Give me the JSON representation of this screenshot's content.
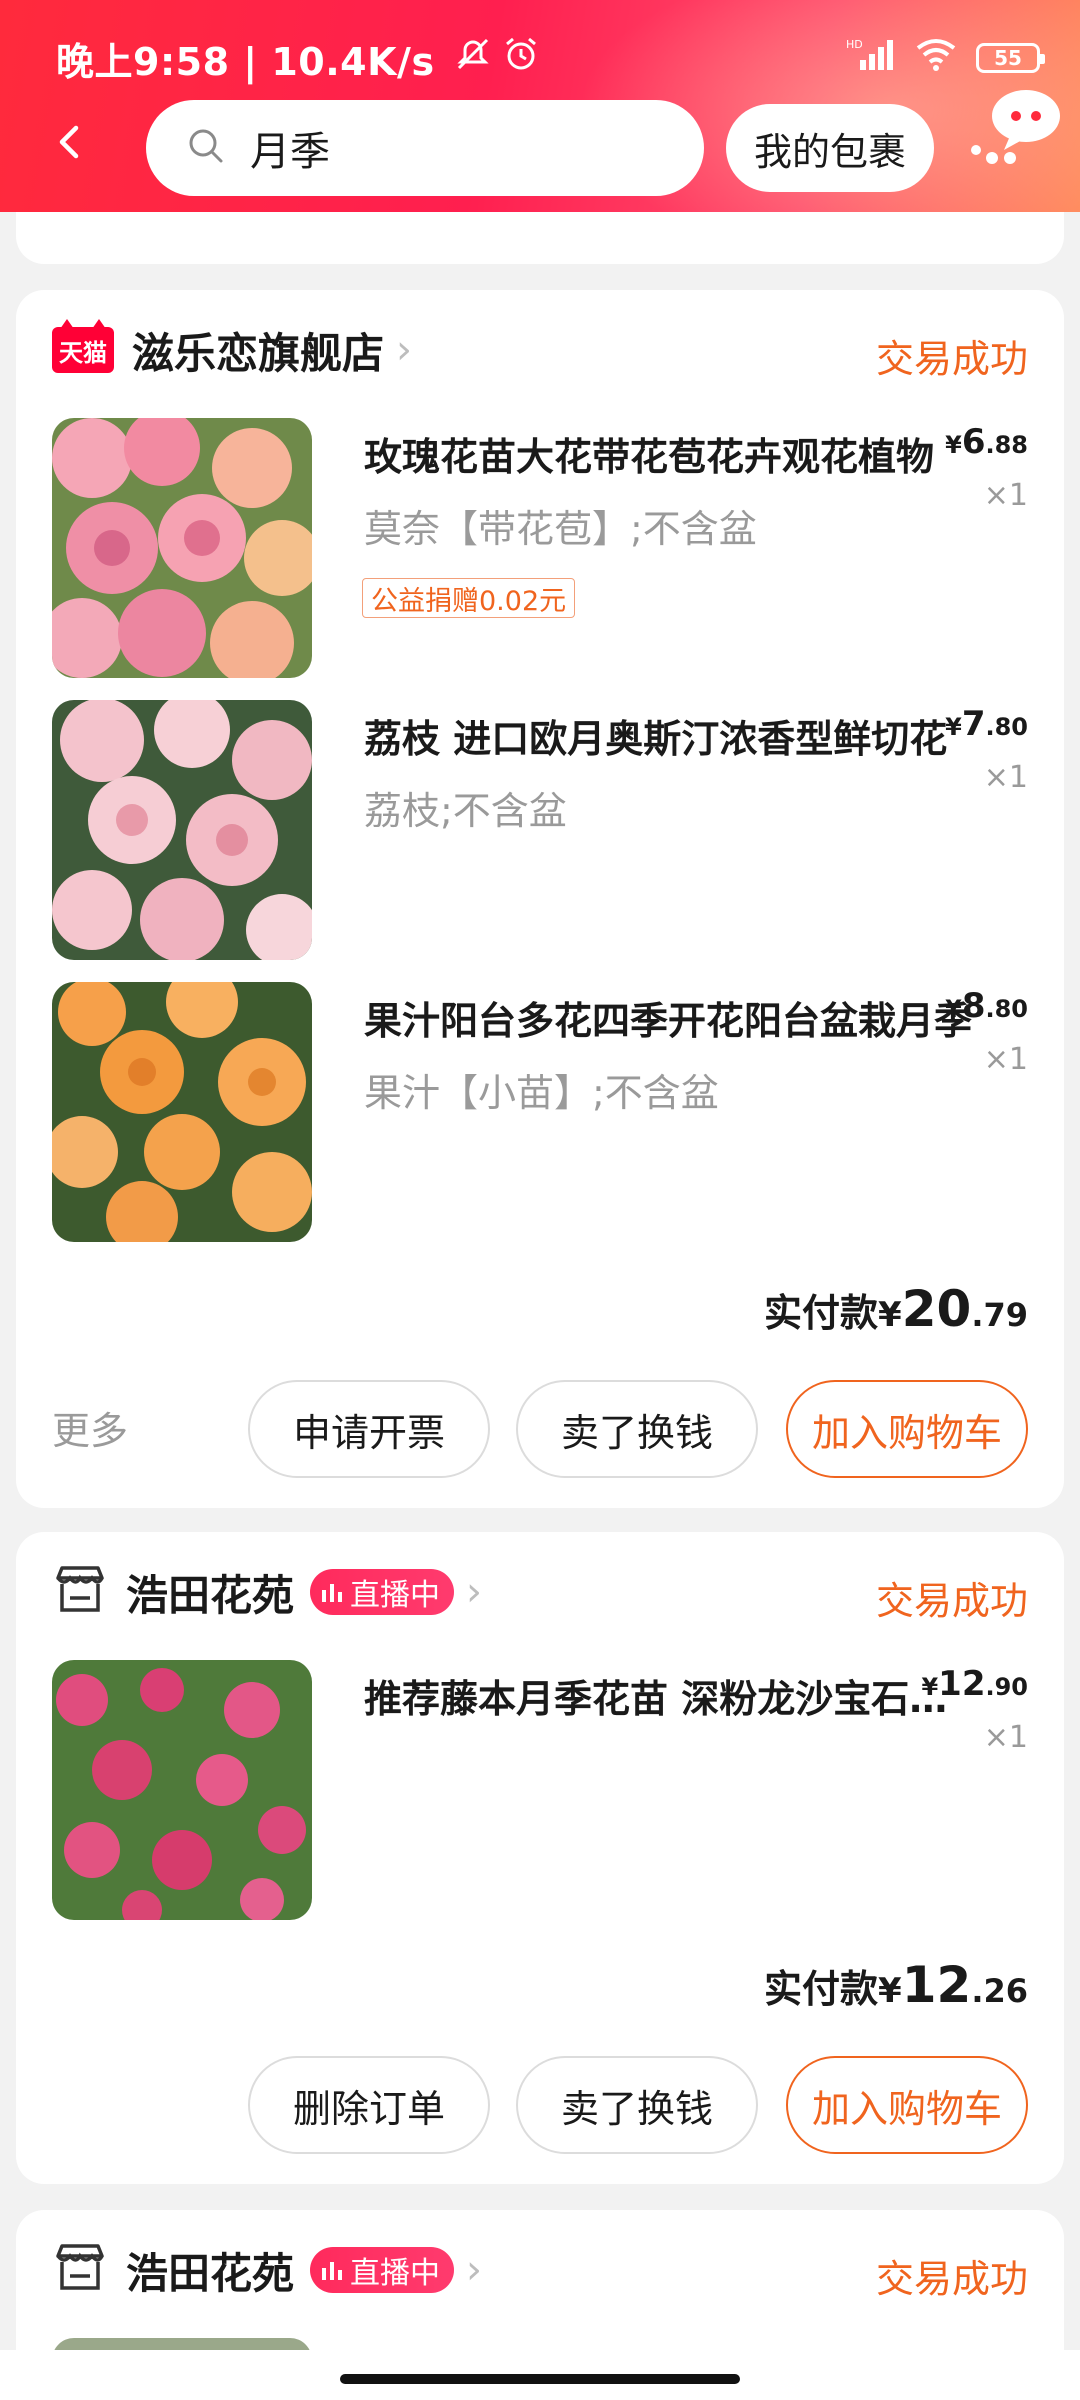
{
  "status_bar": {
    "time": "晚上9:58 | 10.4K/s",
    "battery": "55"
  },
  "header": {
    "search_query": "月季",
    "my_packages": "我的包裹"
  },
  "orders": [
    {
      "shop": "滋乐恋旗舰店",
      "badge": "天猫",
      "status": "交易成功",
      "items": [
        {
          "title": "玫瑰花苗大花带花苞花卉观花植物",
          "sku": "莫奈【带花苞】;不含盆",
          "charity": "公益捐赠0.02元",
          "price_int": "6",
          "price_dec": ".88",
          "qty": "×1"
        },
        {
          "title": "荔枝 进口欧月奥斯汀浓香型鲜切花",
          "sku": "荔枝;不含盆",
          "price_int": "7",
          "price_dec": ".80",
          "qty": "×1"
        },
        {
          "title": "果汁阳台多花四季开花阳台盆栽月季",
          "sku": "果汁【小苗】;不含盆",
          "price_int": "8",
          "price_dec": ".80",
          "qty": "×1"
        }
      ],
      "paid_label": "实付款",
      "paid_int": "20",
      "paid_dec": ".79",
      "more": "更多",
      "buttons": [
        "申请开票",
        "卖了换钱",
        "加入购物车"
      ]
    },
    {
      "shop": "浩田花苑",
      "live": "直播中",
      "status": "交易成功",
      "items": [
        {
          "title": "推荐藤本月季花苗 深粉龙沙宝石爬藤",
          "price_int": "12",
          "price_dec": ".90",
          "qty": "×1"
        }
      ],
      "paid_label": "实付款",
      "paid_int": "12",
      "paid_dec": ".26",
      "buttons": [
        "删除订单",
        "卖了换钱",
        "加入购物车"
      ]
    },
    {
      "shop": "浩田花苑",
      "live": "直播中",
      "status": "交易成功"
    }
  ],
  "currency": "¥",
  "colors": {
    "accent": "#f0641e",
    "header": "#ff2a3c",
    "tmall": "#ff0036"
  }
}
